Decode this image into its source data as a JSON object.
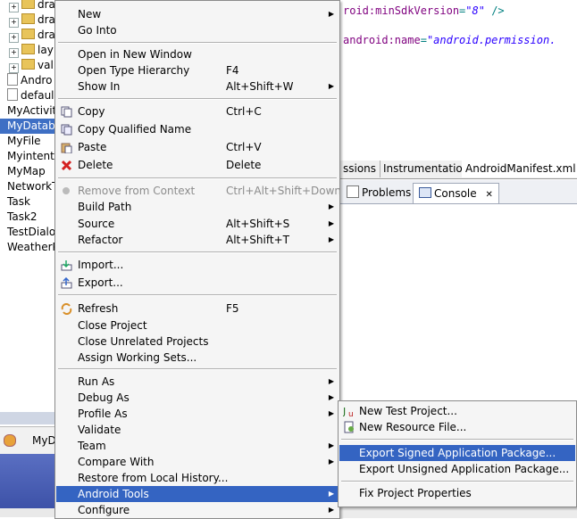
{
  "explorer": {
    "rows": [
      {
        "label": "drawable-hdpi",
        "kind": "folder"
      },
      {
        "label": "dra",
        "kind": "folder"
      },
      {
        "label": "dra",
        "kind": "folder"
      },
      {
        "label": "lay",
        "kind": "folder"
      },
      {
        "label": "val",
        "kind": "folder"
      },
      {
        "label": "Andro",
        "kind": "file"
      },
      {
        "label": "defaul",
        "kind": "file"
      },
      {
        "label": "MyActivit",
        "kind": "project"
      },
      {
        "label": "MyDataba",
        "kind": "project",
        "selected": true
      },
      {
        "label": "MyFile",
        "kind": "project"
      },
      {
        "label": "Myintent",
        "kind": "project"
      },
      {
        "label": "MyMap",
        "kind": "project"
      },
      {
        "label": "NetworkT",
        "kind": "project"
      },
      {
        "label": "Task",
        "kind": "project"
      },
      {
        "label": "Task2",
        "kind": "project"
      },
      {
        "label": "TestDialo",
        "kind": "project"
      },
      {
        "label": "WeatherP",
        "kind": "project"
      }
    ],
    "bottom_tab_label": "MyD"
  },
  "editor": {
    "line1": {
      "attr": "roid:minSdkVersion",
      "eq": "=",
      "str": "\"8\"",
      "end": " />"
    },
    "line2": {
      "attr": "android:name",
      "eq": "=",
      "str": "\"android.permission."
    },
    "tabs": [
      "ssions",
      "Instrumentation",
      "AndroidManifest.xml"
    ]
  },
  "views": {
    "problems": "Problems",
    "console": "Console",
    "close_glyph": "✕"
  },
  "menu": {
    "items": [
      {
        "label": "New",
        "arrow": true
      },
      {
        "label": "Go Into"
      },
      {
        "sep": true
      },
      {
        "label": "Open in New Window"
      },
      {
        "label": "Open Type Hierarchy",
        "accel": "F4"
      },
      {
        "label": "Show In",
        "accel": "Alt+Shift+W",
        "arrow": true
      },
      {
        "sep": true
      },
      {
        "label": "Copy",
        "accel": "Ctrl+C",
        "icon": "copy-icon"
      },
      {
        "label": "Copy Qualified Name",
        "icon": "copy-qualified-icon"
      },
      {
        "label": "Paste",
        "accel": "Ctrl+V",
        "icon": "paste-icon"
      },
      {
        "label": "Delete",
        "accel": "Delete",
        "icon": "delete-icon"
      },
      {
        "sep": true
      },
      {
        "label": "Remove from Context",
        "accel": "Ctrl+Alt+Shift+Down",
        "disabled": true,
        "icon": "remove-context-icon"
      },
      {
        "label": "Build Path",
        "arrow": true
      },
      {
        "label": "Source",
        "accel": "Alt+Shift+S",
        "arrow": true
      },
      {
        "label": "Refactor",
        "accel": "Alt+Shift+T",
        "arrow": true
      },
      {
        "sep": true
      },
      {
        "label": "Import...",
        "icon": "import-icon"
      },
      {
        "label": "Export...",
        "icon": "export-icon"
      },
      {
        "sep": true
      },
      {
        "label": "Refresh",
        "accel": "F5",
        "icon": "refresh-icon"
      },
      {
        "label": "Close Project"
      },
      {
        "label": "Close Unrelated Projects"
      },
      {
        "label": "Assign Working Sets..."
      },
      {
        "sep": true
      },
      {
        "label": "Run As",
        "arrow": true
      },
      {
        "label": "Debug As",
        "arrow": true
      },
      {
        "label": "Profile As",
        "arrow": true
      },
      {
        "label": "Validate"
      },
      {
        "label": "Team",
        "arrow": true
      },
      {
        "label": "Compare With",
        "arrow": true
      },
      {
        "label": "Restore from Local History..."
      },
      {
        "label": "Android Tools",
        "arrow": true,
        "highlighted": true
      },
      {
        "label": "Configure",
        "arrow": true
      }
    ]
  },
  "submenu": {
    "items": [
      {
        "label": "New Test Project...",
        "icon": "junit-project-icon"
      },
      {
        "label": "New Resource File...",
        "icon": "resource-file-icon"
      },
      {
        "sep": true
      },
      {
        "label": "Export Signed Application Package...",
        "highlighted": true
      },
      {
        "label": "Export Unsigned Application Package..."
      },
      {
        "sep": true
      },
      {
        "label": "Fix Project Properties"
      }
    ]
  },
  "colors": {
    "highlight": "#3464c2",
    "menu_bg": "#f5f5f5",
    "delete_red": "#d42020"
  }
}
